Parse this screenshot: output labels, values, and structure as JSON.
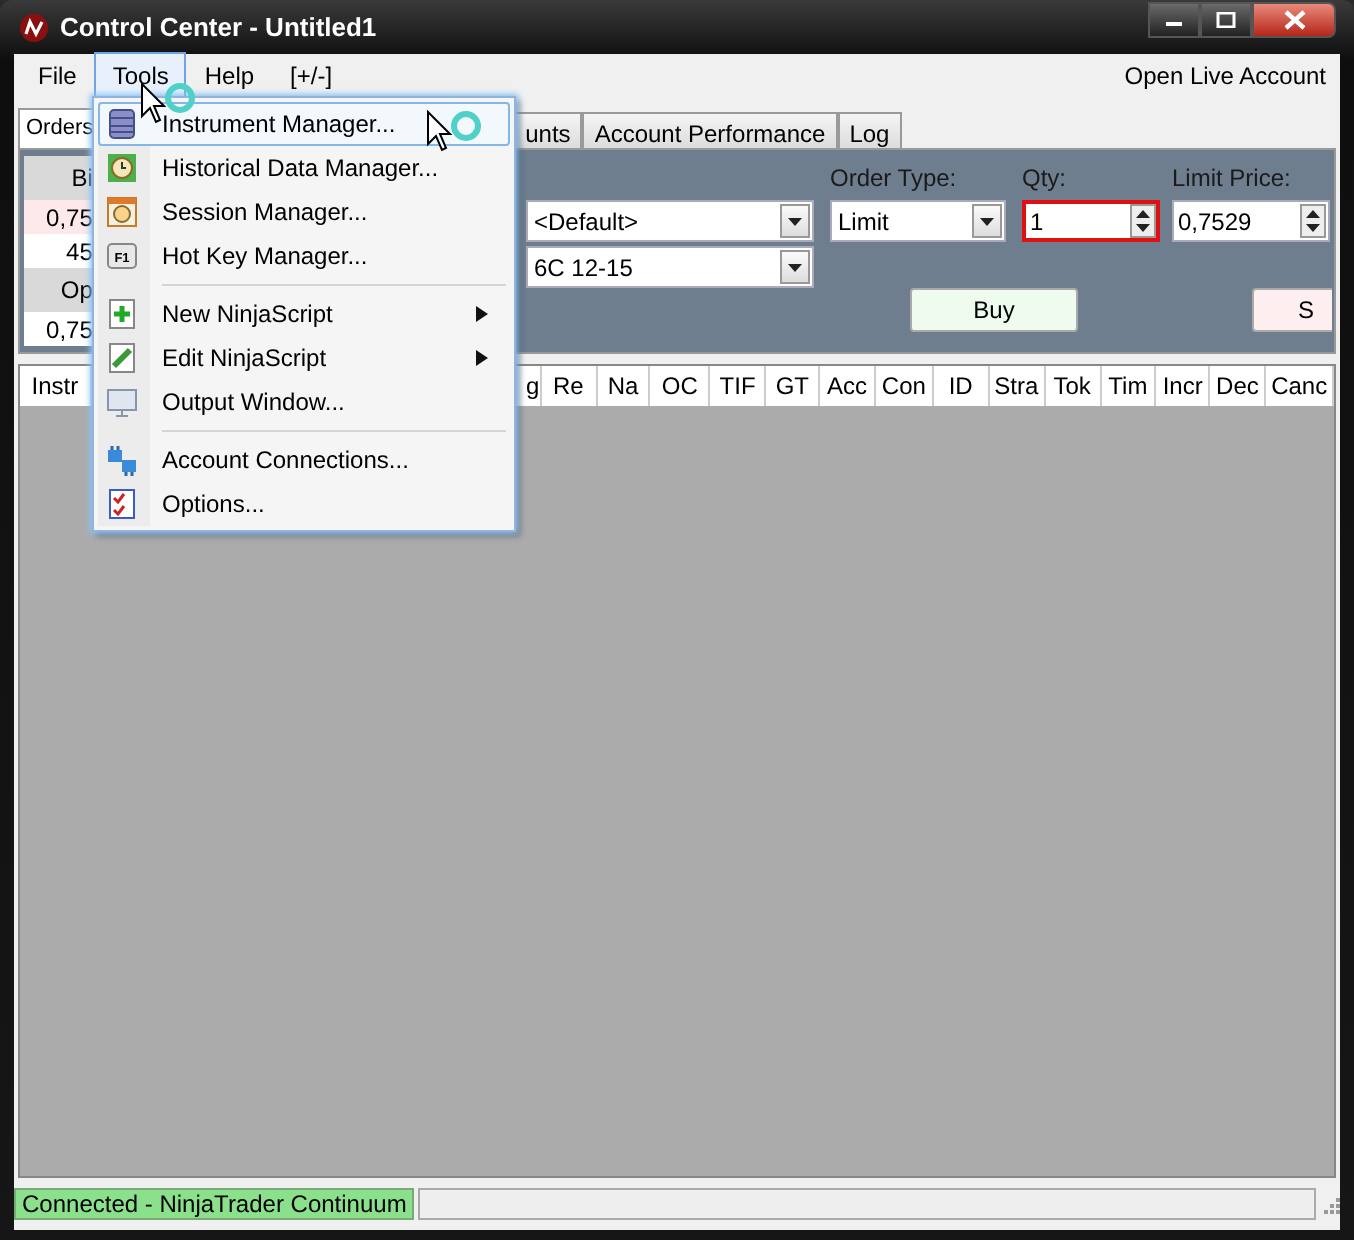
{
  "window": {
    "title": "Control Center - Untitled1"
  },
  "menu_bar": [
    {
      "label": "File",
      "selected": false
    },
    {
      "label": "Tools",
      "selected": true
    },
    {
      "label": "Help",
      "selected": false
    },
    {
      "label": "[+/-]",
      "selected": false
    }
  ],
  "open_live_account": "Open Live Account",
  "tabs": [
    {
      "label": "Orders",
      "selected": true
    },
    {
      "label": "unts",
      "selected": false
    },
    {
      "label": "Account Performance",
      "selected": false
    },
    {
      "label": "Log",
      "selected": false
    }
  ],
  "quote_panel": {
    "bid_label": "Bi",
    "bid_price": "0,75",
    "bid_size": "45",
    "open_label": "Op",
    "open_price": "0,75"
  },
  "order_entry": {
    "account": "<Default>",
    "instrument": "6C 12-15",
    "order_type_label": "Order Type:",
    "order_type": "Limit",
    "qty_label": "Qty:",
    "qty": "1",
    "qty_error": true,
    "limit_price_label": "Limit Price:",
    "limit_price": "0,7529",
    "buy": "Buy",
    "sell": "S"
  },
  "table": {
    "columns": [
      "Instr",
      "g",
      "Re",
      "Na",
      "OC",
      "TIF",
      "GT",
      "Acc",
      "Con",
      "ID",
      "Stra",
      "Tok",
      "Tim",
      "Incr",
      "Dec",
      "Canc"
    ]
  },
  "tools_menu": [
    {
      "kind": "item",
      "label": "Instrument Manager...",
      "selected": true,
      "submenu": false
    },
    {
      "kind": "item",
      "label": "Historical Data Manager...",
      "selected": false,
      "submenu": false
    },
    {
      "kind": "item",
      "label": "Session Manager...",
      "selected": false,
      "submenu": false
    },
    {
      "kind": "item",
      "label": "Hot Key Manager...",
      "selected": false,
      "submenu": false,
      "key": "F1"
    },
    {
      "kind": "separator"
    },
    {
      "kind": "item",
      "label": "New NinjaScript",
      "selected": false,
      "submenu": true
    },
    {
      "kind": "item",
      "label": "Edit NinjaScript",
      "selected": false,
      "submenu": true
    },
    {
      "kind": "item",
      "label": "Output Window...",
      "selected": false,
      "submenu": false
    },
    {
      "kind": "separator"
    },
    {
      "kind": "item",
      "label": "Account Connections...",
      "selected": false,
      "submenu": false
    },
    {
      "kind": "item",
      "label": "Options...",
      "selected": false,
      "submenu": false
    }
  ],
  "status_bar": {
    "connection": "Connected - NinjaTrader Continuum"
  }
}
